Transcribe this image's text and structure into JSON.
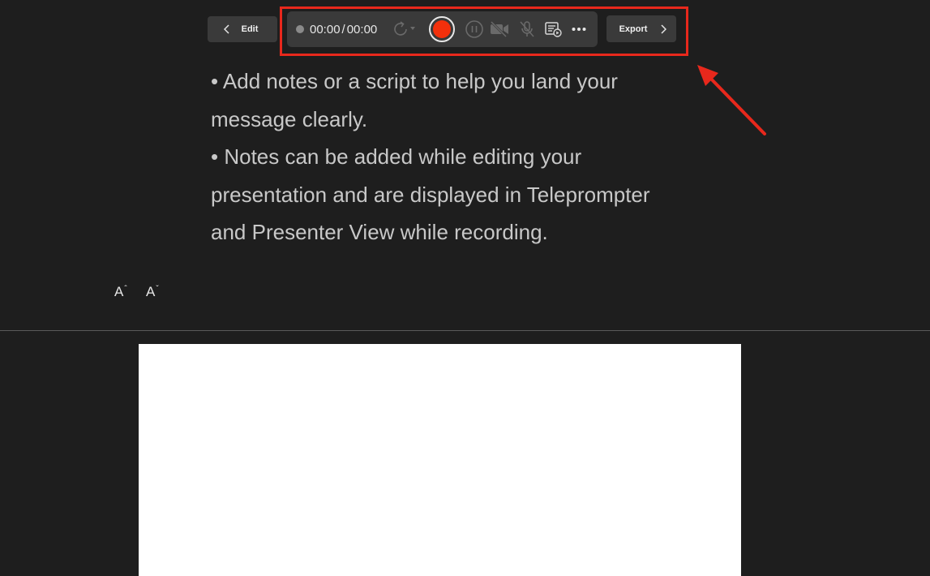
{
  "header": {
    "edit_label": "Edit",
    "export_label": "Export"
  },
  "toolbar": {
    "time_elapsed": "00:00",
    "time_separator": "/",
    "time_total": "00:00",
    "icons": [
      "status-dot",
      "retake-icon",
      "record-icon",
      "pause-icon",
      "camera-off-icon",
      "mic-off-icon",
      "teleprompter-icon",
      "more-icon"
    ]
  },
  "notes": {
    "line1": "• Add notes or a script to help you land your message clearly.",
    "line2": "• Notes can be added while editing your presentation and are displayed in Teleprompter and Presenter View while recording."
  },
  "font_controls": {
    "increase_label": "A",
    "decrease_label": "A",
    "increase_caret": "ˆ",
    "decrease_caret": "ˇ"
  },
  "colors": {
    "background": "#1e1e1e",
    "toolbar_bg": "#3a3a3a",
    "record_red": "#f2300b",
    "annotation_red": "#e8281c",
    "notes_text": "#c8c8c8",
    "slide_bg": "#ffffff"
  }
}
